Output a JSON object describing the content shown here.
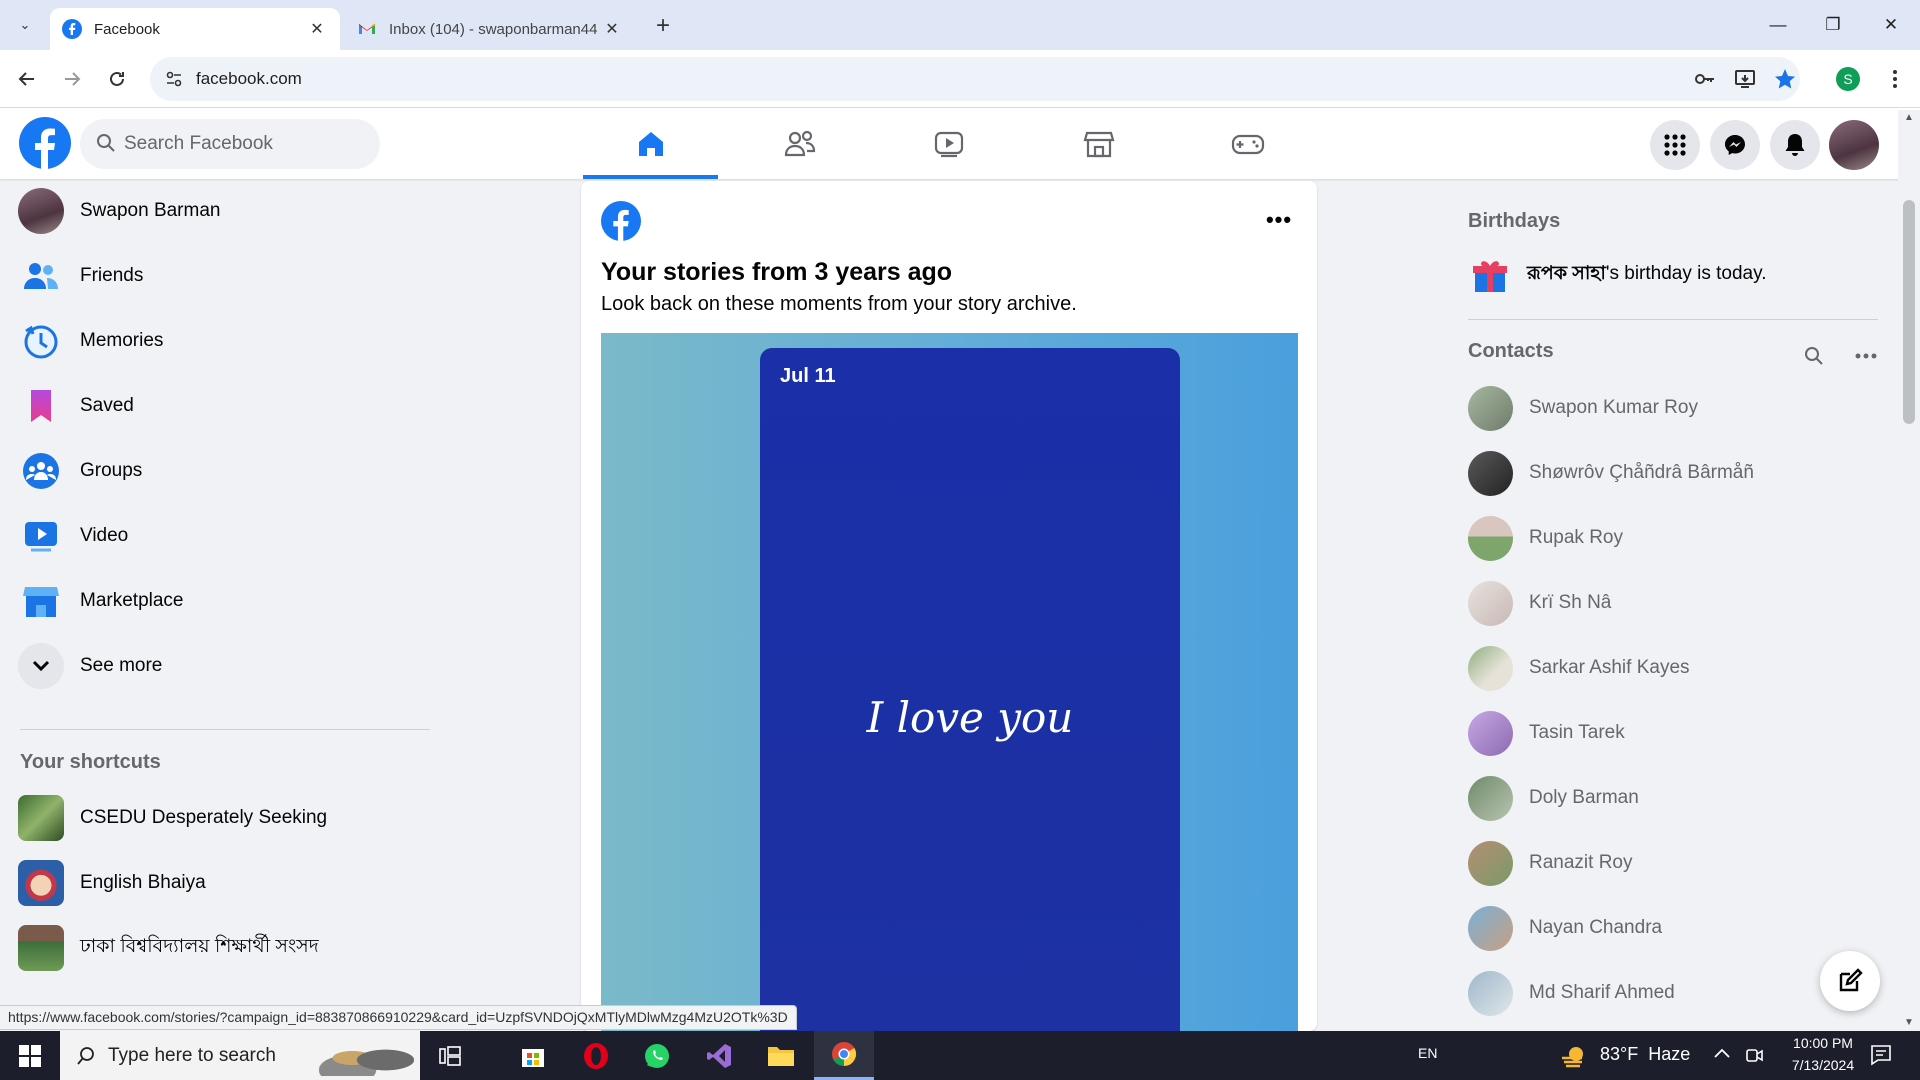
{
  "browser": {
    "tabs": [
      {
        "title": "Facebook",
        "active": true
      },
      {
        "title": "Inbox (104) - swaponbarman44",
        "active": false
      }
    ],
    "url": "facebook.com",
    "profile_initial": "S",
    "status_url": "https://www.facebook.com/stories/?campaign_id=883870866910229&card_id=UzpfSVNDOjQxMTlyMDlwMzg4MzU2OTk%3D"
  },
  "fb_header": {
    "search_placeholder": "Search Facebook"
  },
  "left_nav": {
    "items": [
      {
        "label": "Swapon Barman",
        "icon": "profile-avatar"
      },
      {
        "label": "Friends",
        "icon": "friends-icon"
      },
      {
        "label": "Memories",
        "icon": "memories-icon"
      },
      {
        "label": "Saved",
        "icon": "saved-icon"
      },
      {
        "label": "Groups",
        "icon": "groups-icon"
      },
      {
        "label": "Video",
        "icon": "video-icon"
      },
      {
        "label": "Marketplace",
        "icon": "marketplace-icon"
      },
      {
        "label": "See more",
        "icon": "chevron-down-icon"
      }
    ],
    "shortcuts_heading": "Your shortcuts",
    "shortcuts": [
      {
        "label": "CSEDU Desperately Seeking"
      },
      {
        "label": "English Bhaiya"
      },
      {
        "label": "ঢাকা বিশ্ববিদ্যালয় শিক্ষার্থী সংসদ"
      }
    ]
  },
  "feed": {
    "card": {
      "title": "Your stories from 3 years ago",
      "subtitle": "Look back on these moments from your story archive.",
      "story_date": "Jul 11",
      "story_text": "I love you"
    }
  },
  "right_bar": {
    "birthdays_heading": "Birthdays",
    "birthday_name": "রূপক সাহা",
    "birthday_suffix": "'s birthday is today.",
    "contacts_heading": "Contacts",
    "contacts": [
      {
        "name": "Swapon Kumar Roy"
      },
      {
        "name": "Shøwrôv Çhåñdrâ Bârmåñ"
      },
      {
        "name": "Rupak Roy"
      },
      {
        "name": "Krï Sh Nâ"
      },
      {
        "name": "Sarkar Ashif Kayes"
      },
      {
        "name": "Tasin Tarek"
      },
      {
        "name": "Doly Barman"
      },
      {
        "name": "Ranazit Roy"
      },
      {
        "name": "Nayan Chandra"
      },
      {
        "name": "Md Sharif Ahmed"
      }
    ]
  },
  "taskbar": {
    "search_placeholder": "Type here to search",
    "language": "EN",
    "weather": "83°F  Haze",
    "time": "10:00 PM",
    "date": "7/13/2024"
  },
  "colors": {
    "fb_blue": "#1877f2",
    "story_card": "#1d31a2"
  }
}
